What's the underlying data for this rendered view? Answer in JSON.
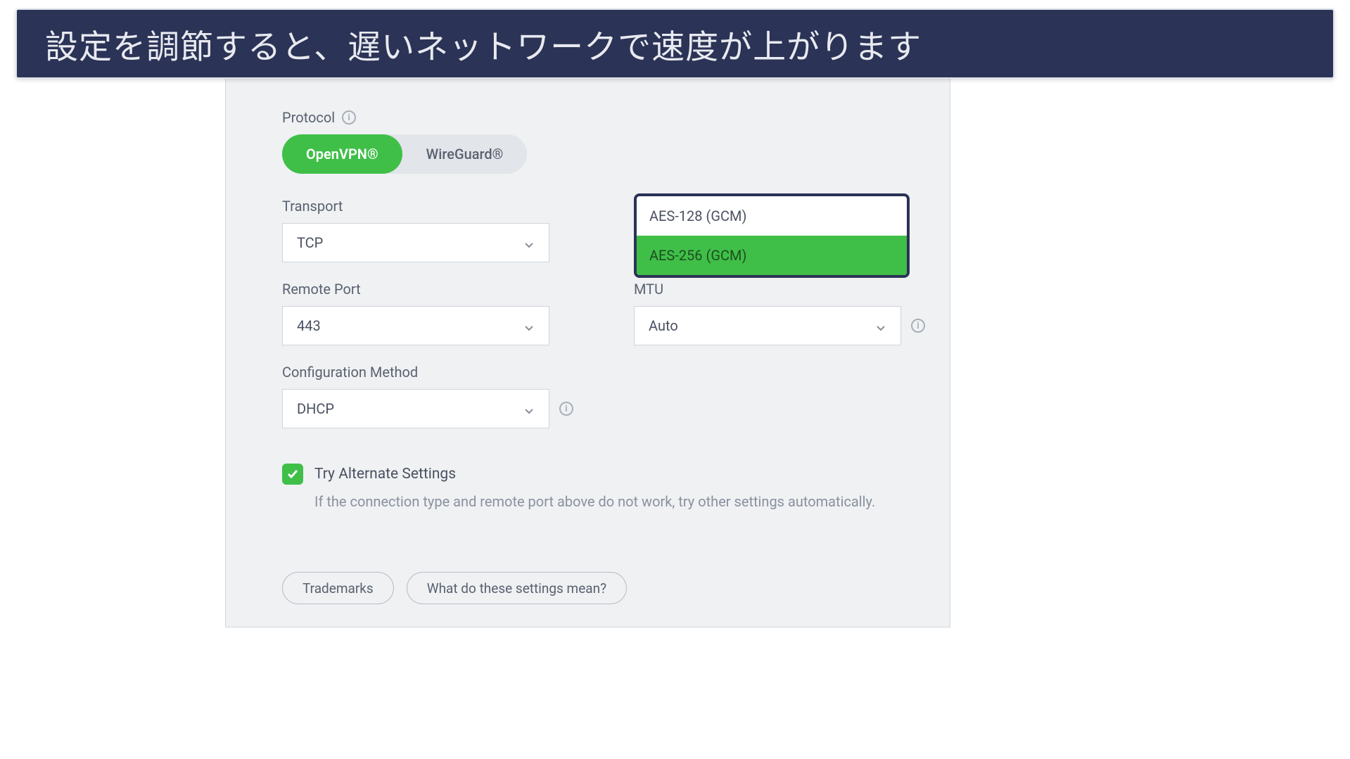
{
  "banner": {
    "text": "設定を調節すると、遅いネットワークで速度が上がります"
  },
  "protocol": {
    "label": "Protocol",
    "options": [
      "OpenVPN®",
      "WireGuard®"
    ],
    "selected": "OpenVPN®"
  },
  "transport": {
    "label": "Transport",
    "value": "TCP"
  },
  "encryption": {
    "options": [
      "AES-128 (GCM)",
      "AES-256 (GCM)"
    ],
    "selected": "AES-256 (GCM)"
  },
  "remote_port": {
    "label": "Remote Port",
    "value": "443"
  },
  "mtu": {
    "label": "MTU",
    "value": "Auto"
  },
  "config_method": {
    "label": "Configuration Method",
    "value": "DHCP"
  },
  "alternate": {
    "label": "Try Alternate Settings",
    "description": "If the connection type and remote port above do not work, try other settings automatically.",
    "checked": true
  },
  "footer": {
    "trademarks": "Trademarks",
    "help": "What do these settings mean?"
  }
}
